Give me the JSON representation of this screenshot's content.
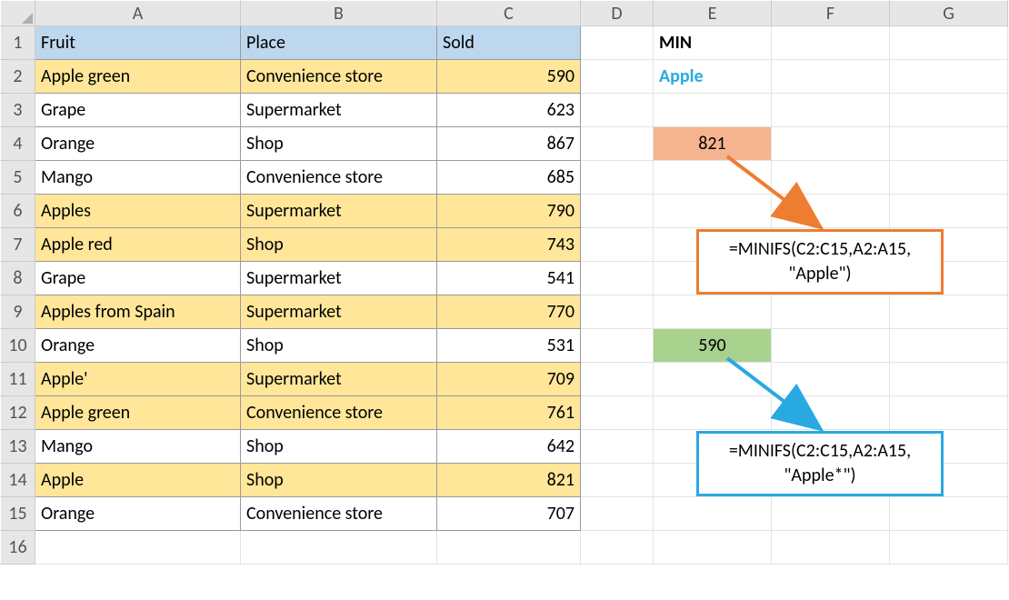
{
  "columns": [
    "A",
    "B",
    "C",
    "D",
    "E",
    "F",
    "G"
  ],
  "row_numbers": [
    1,
    2,
    3,
    4,
    5,
    6,
    7,
    8,
    9,
    10,
    11,
    12,
    13,
    14,
    15,
    16
  ],
  "headers": {
    "fruit": "Fruit",
    "place": "Place",
    "sold": "Sold"
  },
  "rows": [
    {
      "fruit": "Apple green",
      "place": "Convenience store",
      "sold": 590,
      "hl": true
    },
    {
      "fruit": "Grape",
      "place": "Supermarket",
      "sold": 623,
      "hl": false
    },
    {
      "fruit": "Orange",
      "place": "Shop",
      "sold": 867,
      "hl": false
    },
    {
      "fruit": "Mango",
      "place": "Convenience store",
      "sold": 685,
      "hl": false
    },
    {
      "fruit": "Apples",
      "place": "Supermarket",
      "sold": 790,
      "hl": true
    },
    {
      "fruit": "Apple red",
      "place": "Shop",
      "sold": 743,
      "hl": true
    },
    {
      "fruit": "Grape",
      "place": "Supermarket",
      "sold": 541,
      "hl": false
    },
    {
      "fruit": "Apples from Spain",
      "place": "Supermarket",
      "sold": 770,
      "hl": true
    },
    {
      "fruit": "Orange",
      "place": "Shop",
      "sold": 531,
      "hl": false
    },
    {
      "fruit": "Apple'",
      "place": "Supermarket",
      "sold": 709,
      "hl": true
    },
    {
      "fruit": "Apple green",
      "place": "Convenience store",
      "sold": 761,
      "hl": true
    },
    {
      "fruit": "Mango",
      "place": "Shop",
      "sold": 642,
      "hl": false
    },
    {
      "fruit": "Apple",
      "place": "Shop",
      "sold": 821,
      "hl": true
    },
    {
      "fruit": "Orange",
      "place": "Convenience store",
      "sold": 707,
      "hl": false
    }
  ],
  "side": {
    "min_label": "MIN",
    "criteria": "Apple",
    "result_orange": 821,
    "result_green": 590
  },
  "formulas": {
    "orange_line1": "=MINIFS(C2:C15,A2:A15,",
    "orange_line2": "\"Apple\")",
    "blue_line1": "=MINIFS(C2:C15,A2:A15,",
    "blue_line2": "\"Apple*\")"
  },
  "colors": {
    "header_fill": "#bdd7ee",
    "highlight_fill": "#ffe699",
    "orange": "#ed7d31",
    "blue": "#29a9e1",
    "result_orange_fill": "#f5b48f",
    "result_green_fill": "#a9d18e"
  }
}
